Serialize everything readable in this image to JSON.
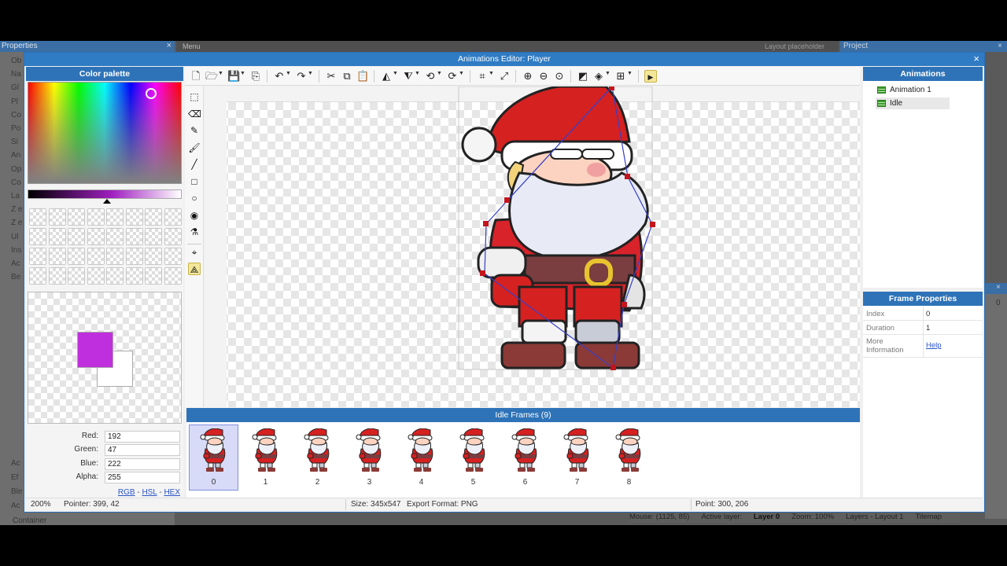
{
  "background": {
    "properties_title": "Properties",
    "properties_items": [
      "Ob",
      "Na",
      "Gl",
      "Pl",
      "Co",
      "Po",
      "Si",
      "An",
      "Op",
      "Co",
      "La",
      "Z e",
      "Z e",
      "Ul",
      "Ins",
      "Ac",
      "Be"
    ],
    "properties_lower": [
      "Ac",
      "Ef",
      "Ble",
      "Ac"
    ],
    "menu_label": "Menu",
    "layout_text": "Layout placeholder",
    "project_title": "Project",
    "right_value": "0",
    "container_label": "Container",
    "status": {
      "mouse": "Mouse: (1125, 85)",
      "active_layer_label": "Active layer:",
      "active_layer": "Layer 0",
      "zoom": "Zoom: 100%",
      "tab_layers": "Layers - Layout 1",
      "tab_tilemap": "Tilemap"
    }
  },
  "modal": {
    "title": "Animations Editor: Player",
    "close_glyph": "×"
  },
  "palette": {
    "title": "Color palette",
    "fields": [
      {
        "label": "Red:",
        "value": "192"
      },
      {
        "label": "Green:",
        "value": "47"
      },
      {
        "label": "Blue:",
        "value": "222"
      },
      {
        "label": "Alpha:",
        "value": "255"
      }
    ],
    "formats": [
      "RGB",
      "HSL",
      "HEX"
    ],
    "fg_color": "#c02fde",
    "bg_color": "#ffffff"
  },
  "toolbar": {
    "icons": [
      "new-icon",
      "open-icon",
      "save-icon",
      "export-icon",
      "undo-icon",
      "redo-icon",
      "cut-icon",
      "copy-icon",
      "paste-icon",
      "flip-horizontal-icon",
      "flip-vertical-icon",
      "rotate-ccw-icon",
      "rotate-cw-icon",
      "crop-icon",
      "resize-icon",
      "zoom-in-icon",
      "zoom-out-icon",
      "zoom-reset-icon",
      "color-mode-icon",
      "layers-icon",
      "grid-icon",
      "preview-icon"
    ]
  },
  "frames": {
    "title": "Idle Frames (9)",
    "selected": 0,
    "items": [
      "0",
      "1",
      "2",
      "3",
      "4",
      "5",
      "6",
      "7",
      "8"
    ]
  },
  "animations": {
    "title": "Animations",
    "items": [
      {
        "label": "Animation 1",
        "selected": false
      },
      {
        "label": "Idle",
        "selected": true
      }
    ]
  },
  "frame_properties": {
    "title": "Frame Properties",
    "rows": [
      {
        "key": "Index",
        "value": "0"
      },
      {
        "key": "Duration",
        "value": "1"
      },
      {
        "key": "More Information",
        "value": "Help"
      }
    ]
  },
  "statusbar": {
    "zoom": "200%",
    "pointer": "Pointer: 399, 42",
    "size": "Size: 345x547",
    "export_format": "Export Format: PNG",
    "point": "Point: 300, 206"
  }
}
